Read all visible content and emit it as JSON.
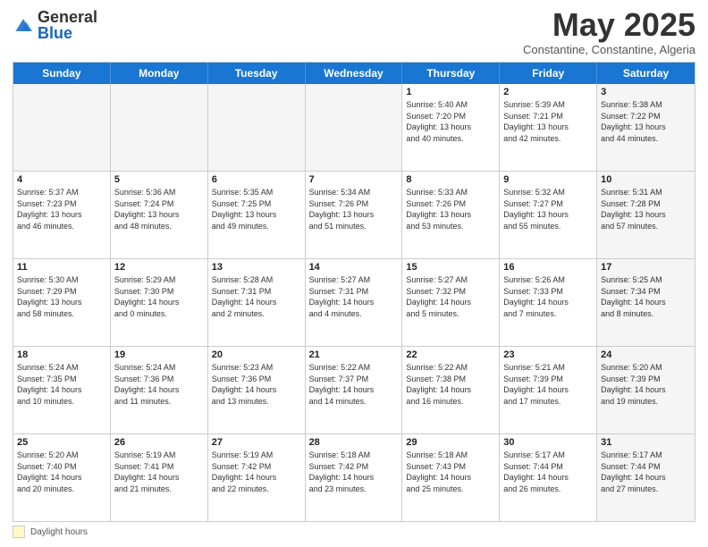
{
  "logo": {
    "general": "General",
    "blue": "Blue"
  },
  "title": "May 2025",
  "subtitle": "Constantine, Constantine, Algeria",
  "days_of_week": [
    "Sunday",
    "Monday",
    "Tuesday",
    "Wednesday",
    "Thursday",
    "Friday",
    "Saturday"
  ],
  "footer": {
    "daylight_label": "Daylight hours"
  },
  "weeks": [
    [
      {
        "day": "",
        "info": "",
        "shaded": true
      },
      {
        "day": "",
        "info": "",
        "shaded": true
      },
      {
        "day": "",
        "info": "",
        "shaded": true
      },
      {
        "day": "",
        "info": "",
        "shaded": true
      },
      {
        "day": "1",
        "info": "Sunrise: 5:40 AM\nSunset: 7:20 PM\nDaylight: 13 hours\nand 40 minutes."
      },
      {
        "day": "2",
        "info": "Sunrise: 5:39 AM\nSunset: 7:21 PM\nDaylight: 13 hours\nand 42 minutes."
      },
      {
        "day": "3",
        "info": "Sunrise: 5:38 AM\nSunset: 7:22 PM\nDaylight: 13 hours\nand 44 minutes.",
        "shaded": true
      }
    ],
    [
      {
        "day": "4",
        "info": "Sunrise: 5:37 AM\nSunset: 7:23 PM\nDaylight: 13 hours\nand 46 minutes."
      },
      {
        "day": "5",
        "info": "Sunrise: 5:36 AM\nSunset: 7:24 PM\nDaylight: 13 hours\nand 48 minutes."
      },
      {
        "day": "6",
        "info": "Sunrise: 5:35 AM\nSunset: 7:25 PM\nDaylight: 13 hours\nand 49 minutes."
      },
      {
        "day": "7",
        "info": "Sunrise: 5:34 AM\nSunset: 7:26 PM\nDaylight: 13 hours\nand 51 minutes."
      },
      {
        "day": "8",
        "info": "Sunrise: 5:33 AM\nSunset: 7:26 PM\nDaylight: 13 hours\nand 53 minutes."
      },
      {
        "day": "9",
        "info": "Sunrise: 5:32 AM\nSunset: 7:27 PM\nDaylight: 13 hours\nand 55 minutes."
      },
      {
        "day": "10",
        "info": "Sunrise: 5:31 AM\nSunset: 7:28 PM\nDaylight: 13 hours\nand 57 minutes.",
        "shaded": true
      }
    ],
    [
      {
        "day": "11",
        "info": "Sunrise: 5:30 AM\nSunset: 7:29 PM\nDaylight: 13 hours\nand 58 minutes."
      },
      {
        "day": "12",
        "info": "Sunrise: 5:29 AM\nSunset: 7:30 PM\nDaylight: 14 hours\nand 0 minutes."
      },
      {
        "day": "13",
        "info": "Sunrise: 5:28 AM\nSunset: 7:31 PM\nDaylight: 14 hours\nand 2 minutes."
      },
      {
        "day": "14",
        "info": "Sunrise: 5:27 AM\nSunset: 7:31 PM\nDaylight: 14 hours\nand 4 minutes."
      },
      {
        "day": "15",
        "info": "Sunrise: 5:27 AM\nSunset: 7:32 PM\nDaylight: 14 hours\nand 5 minutes."
      },
      {
        "day": "16",
        "info": "Sunrise: 5:26 AM\nSunset: 7:33 PM\nDaylight: 14 hours\nand 7 minutes."
      },
      {
        "day": "17",
        "info": "Sunrise: 5:25 AM\nSunset: 7:34 PM\nDaylight: 14 hours\nand 8 minutes.",
        "shaded": true
      }
    ],
    [
      {
        "day": "18",
        "info": "Sunrise: 5:24 AM\nSunset: 7:35 PM\nDaylight: 14 hours\nand 10 minutes."
      },
      {
        "day": "19",
        "info": "Sunrise: 5:24 AM\nSunset: 7:36 PM\nDaylight: 14 hours\nand 11 minutes."
      },
      {
        "day": "20",
        "info": "Sunrise: 5:23 AM\nSunset: 7:36 PM\nDaylight: 14 hours\nand 13 minutes."
      },
      {
        "day": "21",
        "info": "Sunrise: 5:22 AM\nSunset: 7:37 PM\nDaylight: 14 hours\nand 14 minutes."
      },
      {
        "day": "22",
        "info": "Sunrise: 5:22 AM\nSunset: 7:38 PM\nDaylight: 14 hours\nand 16 minutes."
      },
      {
        "day": "23",
        "info": "Sunrise: 5:21 AM\nSunset: 7:39 PM\nDaylight: 14 hours\nand 17 minutes."
      },
      {
        "day": "24",
        "info": "Sunrise: 5:20 AM\nSunset: 7:39 PM\nDaylight: 14 hours\nand 19 minutes.",
        "shaded": true
      }
    ],
    [
      {
        "day": "25",
        "info": "Sunrise: 5:20 AM\nSunset: 7:40 PM\nDaylight: 14 hours\nand 20 minutes."
      },
      {
        "day": "26",
        "info": "Sunrise: 5:19 AM\nSunset: 7:41 PM\nDaylight: 14 hours\nand 21 minutes."
      },
      {
        "day": "27",
        "info": "Sunrise: 5:19 AM\nSunset: 7:42 PM\nDaylight: 14 hours\nand 22 minutes."
      },
      {
        "day": "28",
        "info": "Sunrise: 5:18 AM\nSunset: 7:42 PM\nDaylight: 14 hours\nand 23 minutes."
      },
      {
        "day": "29",
        "info": "Sunrise: 5:18 AM\nSunset: 7:43 PM\nDaylight: 14 hours\nand 25 minutes."
      },
      {
        "day": "30",
        "info": "Sunrise: 5:17 AM\nSunset: 7:44 PM\nDaylight: 14 hours\nand 26 minutes."
      },
      {
        "day": "31",
        "info": "Sunrise: 5:17 AM\nSunset: 7:44 PM\nDaylight: 14 hours\nand 27 minutes.",
        "shaded": true
      }
    ]
  ]
}
